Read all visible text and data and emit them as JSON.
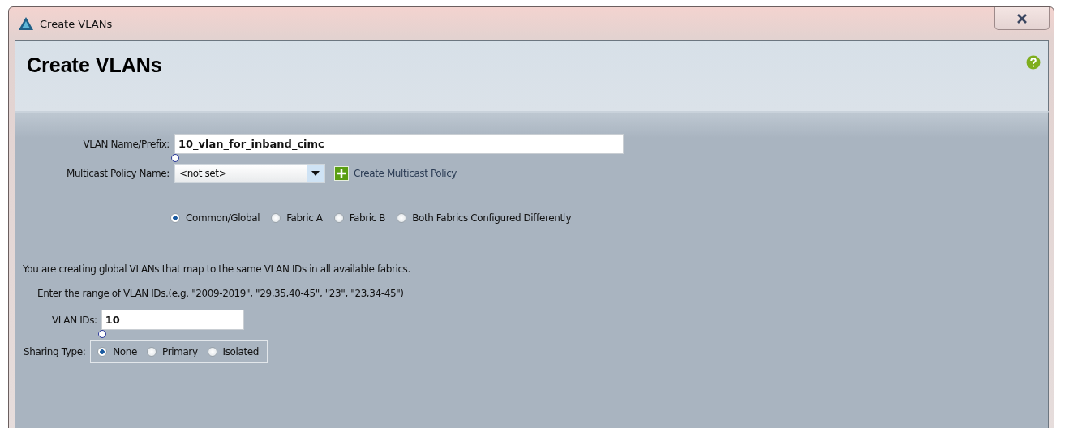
{
  "window": {
    "title": "Create VLANs"
  },
  "header": {
    "title": "Create VLANs"
  },
  "name_field": {
    "label": "VLAN Name/Prefix:",
    "value": "10_vlan_for_inband_cimc"
  },
  "multicast": {
    "label": "Multicast Policy Name:",
    "value": "<not set>",
    "create_link": "Create Multicast Policy"
  },
  "fabric_options": [
    {
      "label": "Common/Global",
      "selected": true
    },
    {
      "label": "Fabric A",
      "selected": false
    },
    {
      "label": "Fabric B",
      "selected": false
    },
    {
      "label": "Both Fabrics Configured Differently",
      "selected": false
    }
  ],
  "info_text": "You are creating global VLANs that map to the same VLAN IDs in all available fabrics.",
  "range_hint": "Enter the range of VLAN IDs.(e.g. \"2009-2019\", \"29,35,40-45\", \"23\", \"23,34-45\")",
  "vlan_ids": {
    "label": "VLAN IDs:",
    "value": "10"
  },
  "sharing_type": {
    "label": "Sharing Type:",
    "options": [
      {
        "label": "None",
        "selected": true
      },
      {
        "label": "Primary",
        "selected": false
      },
      {
        "label": "Isolated",
        "selected": false
      }
    ]
  }
}
